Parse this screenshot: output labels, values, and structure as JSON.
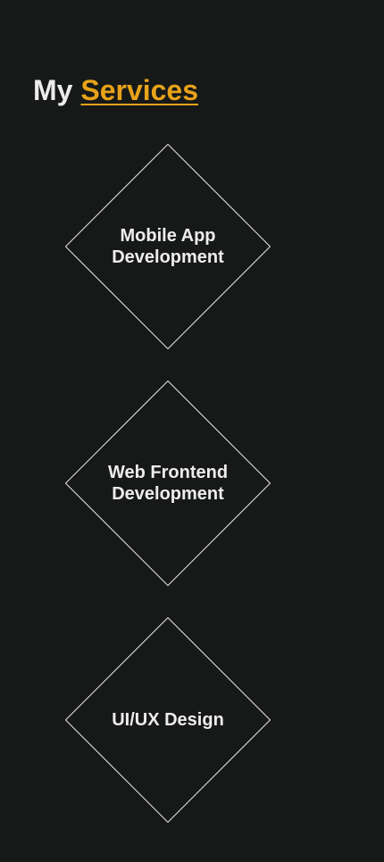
{
  "section": {
    "title_prefix": "My",
    "title_accent": "Services"
  },
  "services": [
    {
      "label": "Mobile App\nDevelopment"
    },
    {
      "label": "Web Frontend\nDevelopment"
    },
    {
      "label": "UI/UX Design"
    }
  ],
  "colors": {
    "background": "#171918",
    "text": "#ECECEC",
    "accent": "#E8A21A",
    "outline": "#E6E6E6"
  }
}
